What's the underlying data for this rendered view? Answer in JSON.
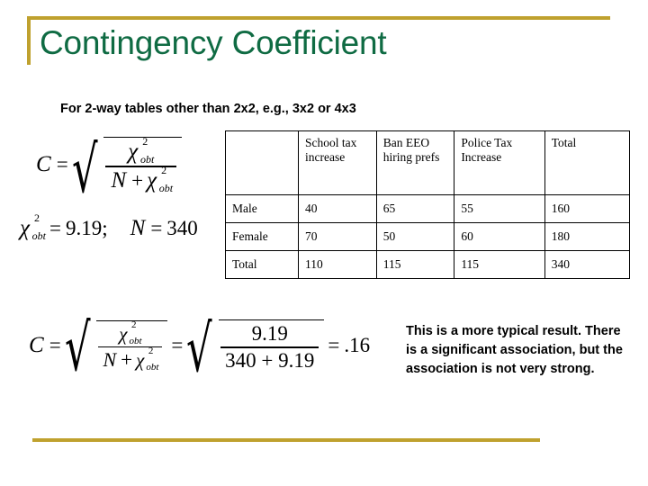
{
  "slide": {
    "title": "Contingency Coefficient",
    "bullet": "For 2-way tables other than 2x2, e.g., 3x2 or 4x3",
    "commentary": "This is a more typical result. There is a significant association, but the association is not very strong.",
    "accent_color": "#bfa12e",
    "title_color": "#0f6b43",
    "text_color": "#000000"
  },
  "formula_1": {
    "lhs": "C",
    "equals": "=",
    "radical_glyph": "√",
    "numerator_base": "χ",
    "numerator_sup": "2",
    "numerator_sub": "obt",
    "denominator_var": "N",
    "denominator_op": "+",
    "denominator_base": "χ",
    "denominator_sup": "2",
    "denominator_sub": "obt"
  },
  "formula_2": {
    "chi_base": "χ",
    "chi_sup": "2",
    "chi_sub": "obt",
    "equals": "=",
    "chi_value": "9.19;",
    "n_var": "N",
    "n_equals": "=",
    "n_value": "340"
  },
  "formula_3": {
    "lhs": "C",
    "equals_1": "=",
    "numerator_base": "χ",
    "numerator_sup": "2",
    "numerator_sub": "obt",
    "denominator_var": "N",
    "denominator_op": "+",
    "denominator_base": "χ",
    "denominator_sup": "2",
    "denominator_sub": "obt",
    "equals_2": "=",
    "numeric_numerator": "9.19",
    "numeric_denominator": "340 + 9.19",
    "equals_3": "=",
    "result": ".16"
  },
  "table": {
    "corner": "",
    "columns": [
      "School tax increase",
      "Ban EEO hiring prefs",
      "Police Tax Increase",
      "Total"
    ],
    "rows": [
      {
        "label": "Male",
        "cells": [
          "40",
          "65",
          "55",
          "160"
        ]
      },
      {
        "label": "Female",
        "cells": [
          "70",
          "50",
          "60",
          "180"
        ]
      },
      {
        "label": "Total",
        "cells": [
          "110",
          "115",
          "115",
          "340"
        ]
      }
    ]
  }
}
